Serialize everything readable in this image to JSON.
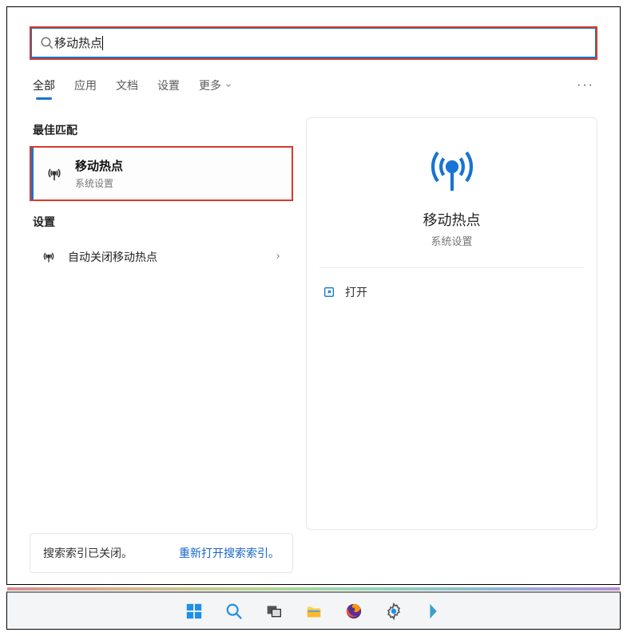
{
  "search": {
    "value": "移动热点"
  },
  "tabs": {
    "all": "全部",
    "apps": "应用",
    "docs": "文档",
    "settings": "设置",
    "more": "更多"
  },
  "sections": {
    "best_match": "最佳匹配",
    "settings": "设置"
  },
  "best_match_item": {
    "title": "移动热点",
    "subtitle": "系统设置"
  },
  "settings_items": [
    {
      "label": "自动关闭移动热点"
    }
  ],
  "preview": {
    "title": "移动热点",
    "subtitle": "系统设置",
    "open_label": "打开"
  },
  "index_bar": {
    "message": "搜索索引已关闭。",
    "link": "重新打开搜索索引。"
  }
}
